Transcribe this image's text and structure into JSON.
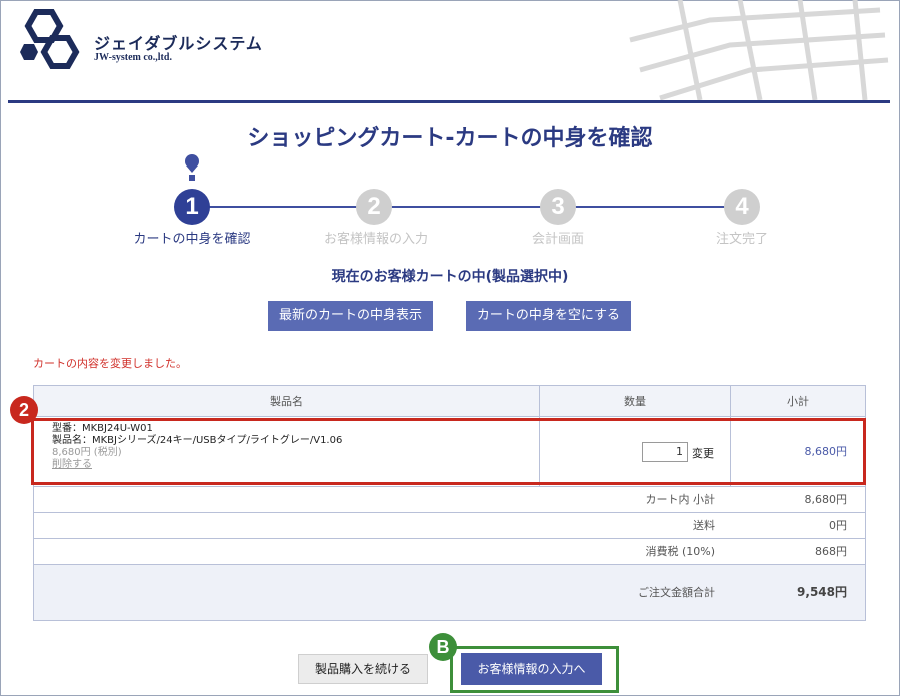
{
  "brand": {
    "name": "ジェイダブルシステム",
    "sub": "JW-system co.,ltd."
  },
  "page_title": "ショッピングカート-カートの中身を確認",
  "steps": [
    {
      "num": "1",
      "label": "カートの中身を確認"
    },
    {
      "num": "2",
      "label": "お客様情報の入力"
    },
    {
      "num": "3",
      "label": "会計画面"
    },
    {
      "num": "4",
      "label": "注文完了"
    }
  ],
  "cart_status": "現在のお客様カートの中(製品選択中)",
  "buttons": {
    "show_latest": "最新のカートの中身表示",
    "empty_cart": "カートの中身を空にする",
    "continue": "製品購入を続ける",
    "next": "お客様情報の入力へ"
  },
  "notice": "カートの内容を変更しました。",
  "table": {
    "headers": [
      "製品名",
      "数量",
      "小計"
    ],
    "item": {
      "model": "型番：MKBJ24U-W01",
      "name": "製品名：MKBJシリーズ/24キー/USBタイプ/ライトグレー/V1.06",
      "price": "8,680円 (税別)",
      "delete": "削除する",
      "qty": "1",
      "change": "変更",
      "subtotal": "8,680円"
    },
    "summary": [
      {
        "label": "カート内 小計",
        "value": "8,680円"
      },
      {
        "label": "送料",
        "value": "0円"
      },
      {
        "label": "消費税 (10%)",
        "value": "868円"
      }
    ],
    "total": {
      "label": "ご注文金額合計",
      "value": "9,548円"
    }
  },
  "annotations": {
    "red": "2",
    "green": "B"
  }
}
